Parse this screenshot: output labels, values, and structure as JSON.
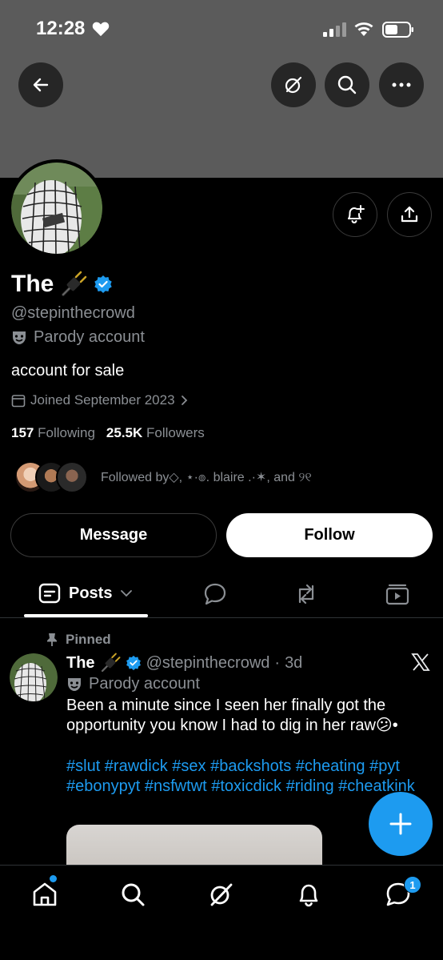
{
  "status_bar": {
    "time": "12:28"
  },
  "profile": {
    "name": "The",
    "handle": "@stepinthecrowd",
    "parody_label": "Parody account",
    "bio": "account for sale",
    "joined": "Joined September 2023",
    "following_count": "157",
    "following_label": "Following",
    "followers_count": "25.5K",
    "followers_label": "Followers",
    "followed_by": "Followed by◇, ⋆·๏. blaire .·✶, and ୨୧"
  },
  "actions": {
    "message_label": "Message",
    "follow_label": "Follow"
  },
  "tabs": {
    "posts_label": "Posts"
  },
  "post": {
    "pinned_label": "Pinned",
    "name": "The",
    "handle": "@stepinthecrowd",
    "separator": "·",
    "time": "3d",
    "parody_label": "Parody account",
    "text": "Been a minute since I seen her finally got the opportunity you know I had to dig in her raw😕•",
    "hashtags": "#slut #rawdick #sex #backshots #cheating #pyt #ebonypyt #nsfwtwt #toxicdick #riding #cheatkink"
  },
  "bottom_nav": {
    "messages_badge": "1"
  },
  "colors": {
    "accent": "#1d9bf0",
    "banner": "#5b5b5b",
    "muted": "#8b8f94"
  }
}
